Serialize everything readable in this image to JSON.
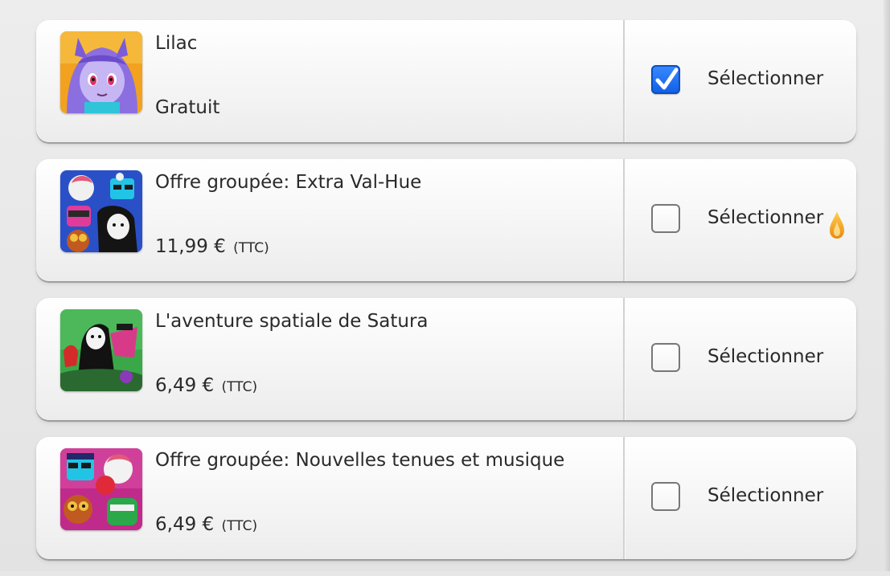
{
  "items": [
    {
      "title": "Lilac",
      "price": "Gratuit",
      "tax": "",
      "selected": true,
      "select_label": "Sélectionner",
      "icon": "lilac-character-icon"
    },
    {
      "title": "Offre groupée: Extra Val-Hue",
      "price": "11,99 €",
      "tax": "(TTC)",
      "selected": false,
      "select_label": "Sélectionner",
      "icon": "extra-val-hue-bundle-icon"
    },
    {
      "title": "L'aventure spatiale de Satura",
      "price": "6,49 €",
      "tax": "(TTC)",
      "selected": false,
      "select_label": "Sélectionner",
      "icon": "satura-space-adventure-icon"
    },
    {
      "title": "Offre groupée: Nouvelles tenues et musique",
      "price": "6,49 €",
      "tax": "(TTC)",
      "selected": false,
      "select_label": "Sélectionner",
      "icon": "outfits-music-bundle-icon"
    }
  ],
  "colors": {
    "checkbox_checked": "#1a6cf0",
    "text": "#2a2a2a",
    "cursor_flame": "#f0a020"
  }
}
